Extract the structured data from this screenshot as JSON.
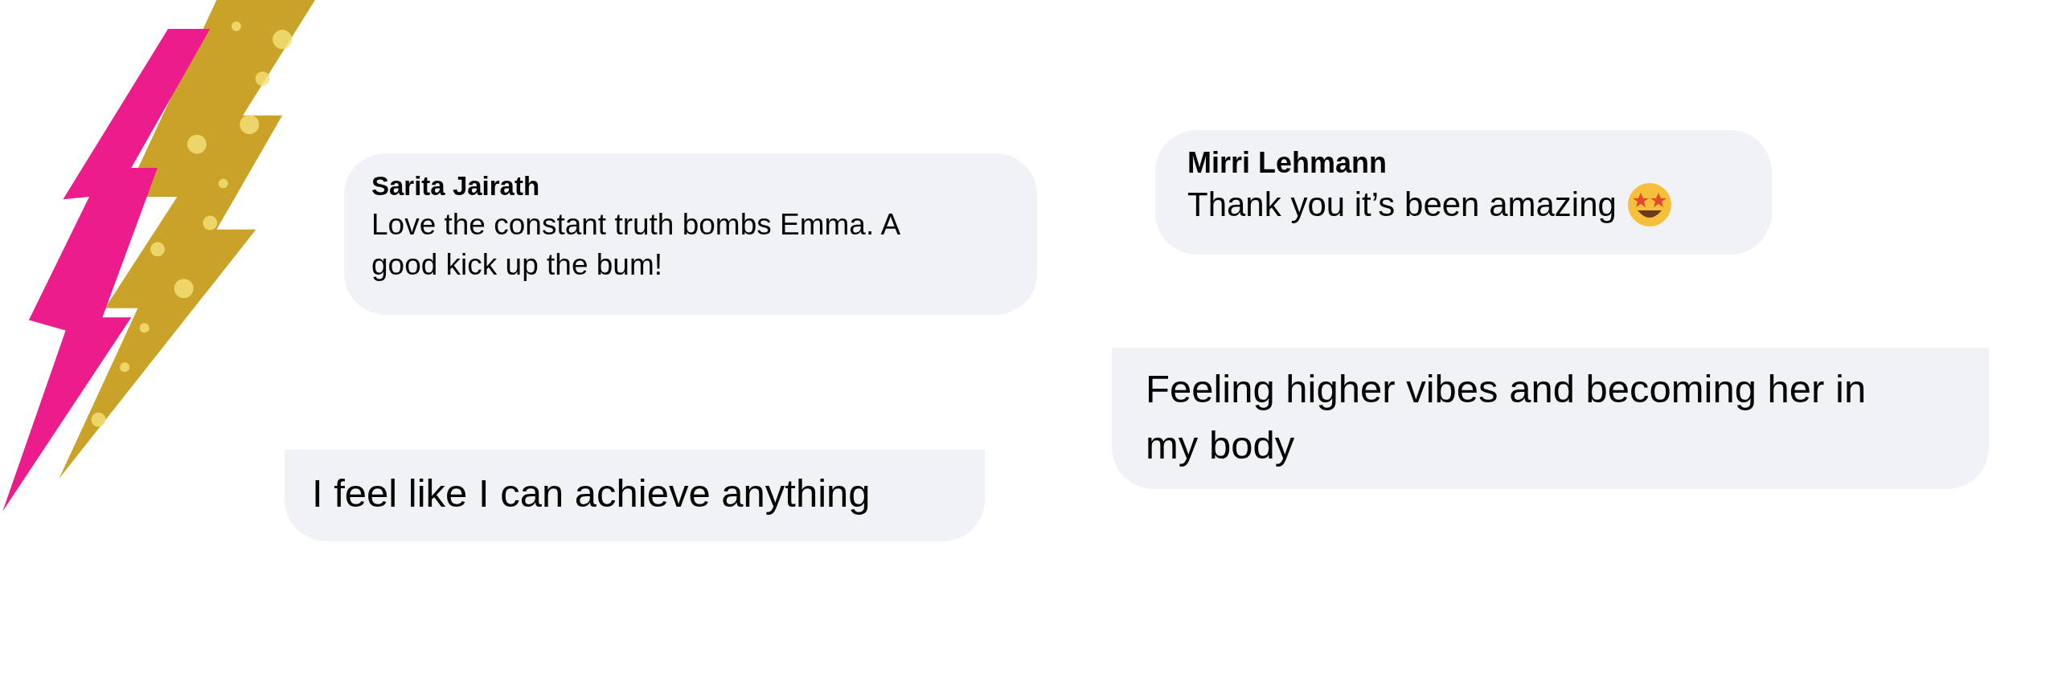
{
  "comments": [
    {
      "name": "Sarita Jairath",
      "text": "Love the constant truth bombs Emma. A\ngood kick up the bum!",
      "cut_top": false
    },
    {
      "name": "Mirri Lehmann",
      "text": "Thank you it’s been amazing",
      "emoji": true,
      "cut_top": false
    },
    {
      "text": "I feel like I can achieve anything",
      "cut_top": true
    },
    {
      "text": "Feeling higher vibes and becoming her in\nmy body",
      "cut_top": true
    }
  ]
}
